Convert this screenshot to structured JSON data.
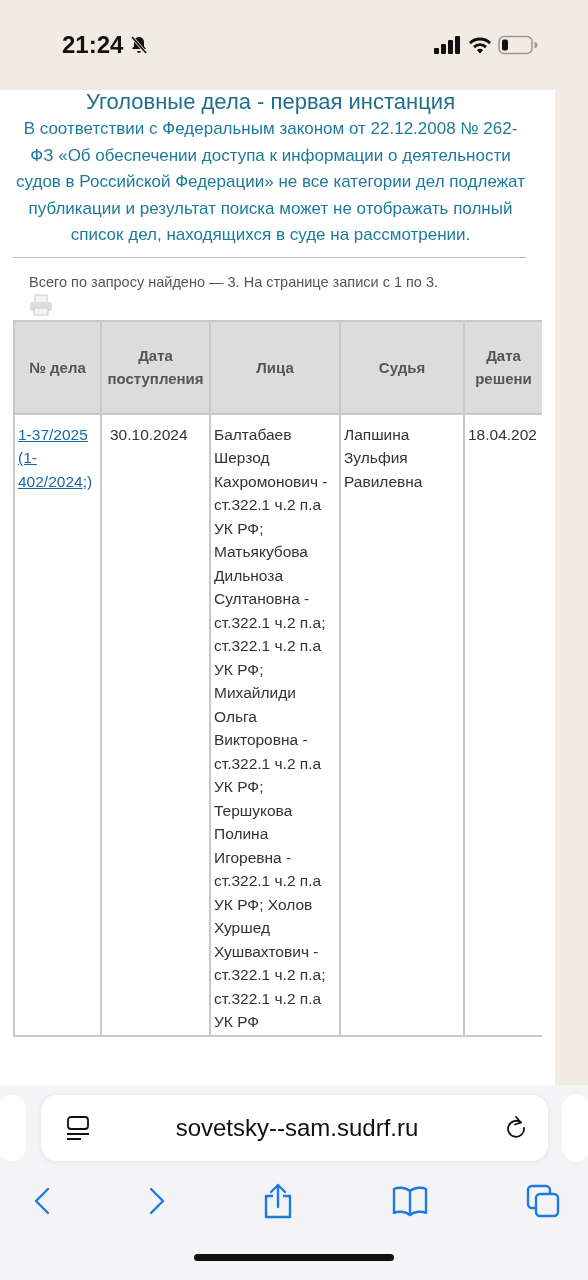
{
  "status_bar": {
    "time": "21:24"
  },
  "page": {
    "title": "Уголовные дела - первая инстанция",
    "notice": "В соответствии с Федеральным законом от 22.12.2008 № 262-ФЗ «Об обеспечении доступа к информации о деятельности судов в Российской Федерации» не все категории дел подлежат публикации и результат поиска может не отображать полный список дел, находящихся в суде на рассмотрении.",
    "count_text": "Всего по запросу найдено — 3. На странице записи с 1 по 3."
  },
  "table": {
    "columns": [
      "№ дела",
      "Дата поступления",
      "Лица",
      "Судья",
      "Дата решени"
    ],
    "rows": [
      {
        "case_number": "1-37/2025",
        "linked_case": "(1-402/2024",
        "case_suffix": ";)",
        "received": "30.10.2024",
        "persons": "Балтабаев Шерзод Кахромонович - ст.322.1 ч.2 п.а УК РФ; Матьякубова Дильноза Султановна - ст.322.1 ч.2 п.а; ст.322.1 ч.2 п.а УК РФ; Михайлиди Ольга Викторовна - ст.322.1 ч.2 п.а УК РФ; Тершукова Полина Игоревна - ст.322.1 ч.2 п.а УК РФ; Холов Хуршед Хушвахтович - ст.322.1 ч.2 п.а; ст.322.1 ч.2 п.а УК РФ",
        "judge": "Лапшина Зульфия Равилевна",
        "decision_date": "18.04.202"
      }
    ]
  },
  "browser": {
    "url": "sovetsky--sam.sudrf.ru"
  }
}
